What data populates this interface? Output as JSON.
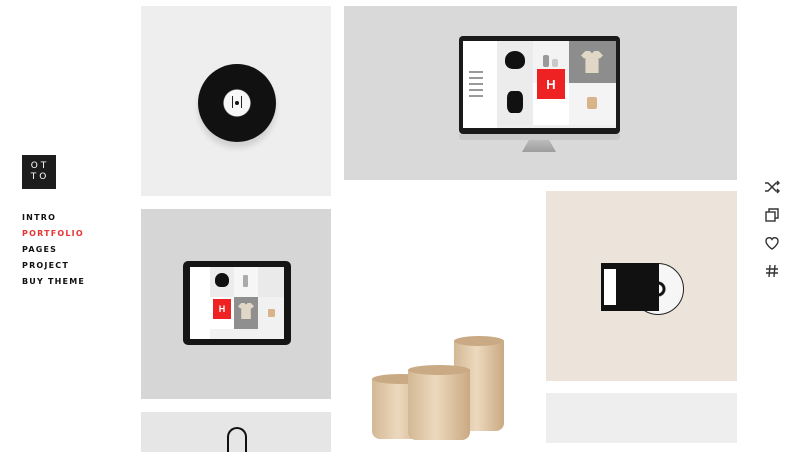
{
  "brand": {
    "logo_line1": "OT",
    "logo_line2": "TO"
  },
  "nav": {
    "items": [
      {
        "label": "INTRO"
      },
      {
        "label": "PORTFOLIO",
        "active": true
      },
      {
        "label": "PAGES"
      },
      {
        "label": "PROJECT"
      },
      {
        "label": "BUY THEME"
      }
    ]
  },
  "portfolio": {
    "h_letter": "H"
  },
  "side_icons": [
    "shuffle-icon",
    "copy-icon",
    "heart-icon",
    "hashtag-icon"
  ],
  "colors": {
    "accent": "#e63535",
    "text": "#111111",
    "logo_bg": "#1c1c1c"
  }
}
